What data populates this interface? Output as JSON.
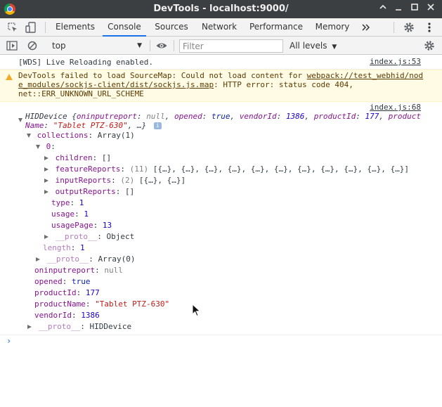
{
  "window": {
    "title": "DevTools - localhost:9000/"
  },
  "tabs": [
    {
      "label": "Elements",
      "active": false
    },
    {
      "label": "Console",
      "active": true
    },
    {
      "label": "Sources",
      "active": false
    },
    {
      "label": "Network",
      "active": false
    },
    {
      "label": "Performance",
      "active": false
    },
    {
      "label": "Memory",
      "active": false
    }
  ],
  "toolbar": {
    "context": "top",
    "filter_placeholder": "Filter",
    "levels": "All levels"
  },
  "messages": {
    "wds": {
      "text": "[WDS] Live Reloading enabled.",
      "source": "index.js:53"
    },
    "warning": {
      "line1_prefix": "DevTools failed to load SourceMap: Could not load content for ",
      "line1_link": "webpack://test_webhid/nod",
      "line2_link": "e_modules/sockjs-client/dist/sockjs.js.map",
      "line2_suffix": ": HTTP error: status code 404,",
      "line3": "net::ERR_UNKNOWN_URL_SCHEME"
    },
    "log_source": "index.js:68"
  },
  "tree": {
    "summary_name": "HIDDevice",
    "summary_open": "{",
    "summary_k1": "oninputreport",
    "summary_v1": "null",
    "summary_k2": "opened",
    "summary_v2": "true",
    "summary_k3": "vendorId",
    "summary_v3": "1386",
    "summary_k4": "productId",
    "summary_v4": "177",
    "summary_k5a": "product",
    "summary_k5b": "Name",
    "summary_v5": "\"Tablet PTZ-630\"",
    "summary_tail": ", …}",
    "info_badge": "i",
    "collections_key": "collections",
    "collections_val": "Array(1)",
    "idx0_key": "0",
    "children_key": "children",
    "children_val": "[]",
    "featureReports_key": "featureReports",
    "featureReports_count": "(11)",
    "featureReports_val": "[{…}, {…}, {…}, {…}, {…}, {…}, {…}, {…}, {…}, {…}, {…}]",
    "inputReports_key": "inputReports",
    "inputReports_count": "(2)",
    "inputReports_val": "[{…}, {…}]",
    "outputReports_key": "outputReports",
    "outputReports_val": "[]",
    "type_key": "type",
    "type_val": "1",
    "usage_key": "usage",
    "usage_val": "1",
    "usagePage_key": "usagePage",
    "usagePage_val": "13",
    "proto_key": "__proto__",
    "proto_obj_val": "Object",
    "length_key": "length",
    "length_val": "1",
    "proto_arr_val": "Array(0)",
    "oninputreport_key": "oninputreport",
    "oninputreport_val": "null",
    "opened_key": "opened",
    "opened_val": "true",
    "productId_key": "productId",
    "productId_val": "177",
    "productName_key": "productName",
    "productName_val": "\"Tablet PTZ-630\"",
    "vendorId_key": "vendorId",
    "vendorId_val": "1386",
    "proto_hid_val": "HIDDevice",
    "colon": ":"
  },
  "prompt": {
    "symbol": "›"
  },
  "icons": {
    "app": "chrome-icon",
    "inspect": "inspect-element-icon",
    "device": "device-toolbar-icon",
    "more_tabs": "chevron-double-right-icon",
    "settings": "gear-icon",
    "menu": "kebab-menu-icon",
    "sidebar": "show-sidebar-icon",
    "clear": "clear-console-icon",
    "eye": "eye-icon"
  }
}
